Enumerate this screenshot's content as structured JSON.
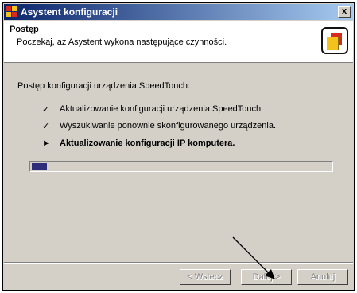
{
  "window": {
    "title": "Asystent konfiguracji",
    "close_label": "x"
  },
  "header": {
    "title": "Postęp",
    "subtitle": "Poczekaj, aż Asystent wykona następujące czynności."
  },
  "main": {
    "progress_label": "Postęp konfiguracji urządzenia SpeedTouch:",
    "steps": [
      {
        "mark": "✓",
        "text": "Aktualizowanie konfiguracji urządzenia SpeedTouch.",
        "status": "done"
      },
      {
        "mark": "✓",
        "text": "Wyszukiwanie ponownie skonfigurowanego urządzenia.",
        "status": "done"
      },
      {
        "mark": "►",
        "text": "Aktualizowanie konfiguracji IP komputera.",
        "status": "current"
      }
    ],
    "progress_fraction": 0.05
  },
  "buttons": {
    "back": "< Wstecz",
    "next": "Dalej >",
    "cancel": "Anuluj"
  },
  "colors": {
    "title_start": "#0a246a",
    "title_end": "#a6caf0",
    "progress": "#2d2d7a",
    "face": "#d4d0c8"
  }
}
